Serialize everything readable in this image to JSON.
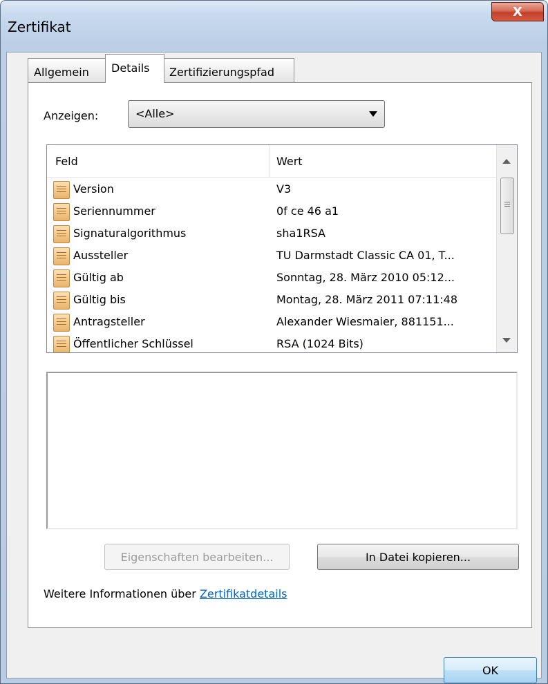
{
  "window": {
    "title": "Zertifikat",
    "close_glyph": "X"
  },
  "tabs": [
    {
      "label": "Allgemein",
      "active": false
    },
    {
      "label": "Details",
      "active": true
    },
    {
      "label": "Zertifizierungspfad",
      "active": false
    }
  ],
  "show": {
    "label": "Anzeigen:",
    "selected": "<Alle>"
  },
  "list": {
    "columns": [
      "Feld",
      "Wert"
    ],
    "rows": [
      {
        "field": "Version",
        "value": "V3"
      },
      {
        "field": "Seriennummer",
        "value": "0f ce 46 a1"
      },
      {
        "field": "Signaturalgorithmus",
        "value": "sha1RSA"
      },
      {
        "field": "Aussteller",
        "value": "TU Darmstadt Classic CA 01, T..."
      },
      {
        "field": "Gültig ab",
        "value": "Sonntag, 28. März 2010 05:12..."
      },
      {
        "field": "Gültig bis",
        "value": "Montag, 28. März 2011 07:11:48"
      },
      {
        "field": "Antragsteller",
        "value": "Alexander Wiesmaier, 881151..."
      },
      {
        "field": "Öffentlicher Schlüssel",
        "value": "RSA (1024 Bits)"
      }
    ]
  },
  "buttons": {
    "edit": "Eigenschaften bearbeiten...",
    "copy": "In Datei kopieren...",
    "ok": "OK"
  },
  "info": {
    "text": "Weitere Informationen über ",
    "link": "Zertifikatdetails"
  },
  "colors": {
    "link": "#0066cc",
    "close_button": "#c2402c",
    "ok_button": "#bfe0f7"
  }
}
